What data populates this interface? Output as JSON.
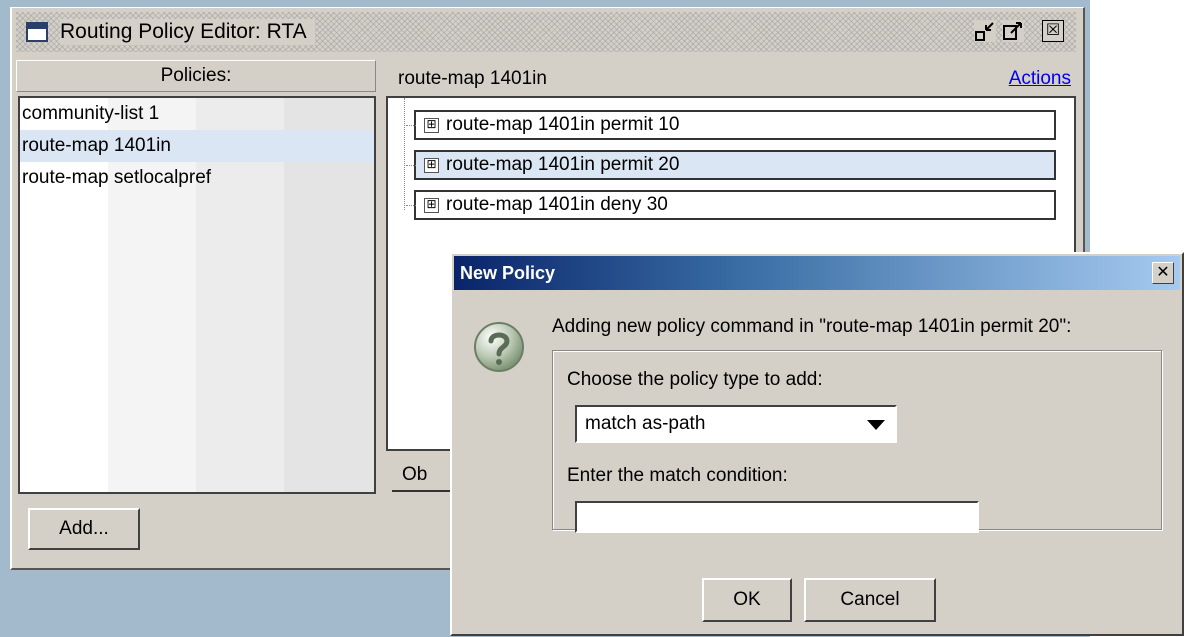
{
  "main_window": {
    "title": "Routing Policy Editor: RTA",
    "minimize_icon": "minimize-icon",
    "maximize_icon": "maximize-icon",
    "close_icon": "close-icon",
    "close_glyph": "☒"
  },
  "left_panel": {
    "header": "Policies:",
    "items": [
      {
        "label": "community-list 1",
        "selected": false
      },
      {
        "label": "route-map 1401in",
        "selected": true
      },
      {
        "label": "route-map setlocalpref",
        "selected": false
      }
    ],
    "add_button": "Add..."
  },
  "right_panel": {
    "title": "route-map 1401in",
    "actions_link": "Actions",
    "tree": [
      {
        "label": "route-map 1401in permit 10",
        "expand": "⊞",
        "selected": false
      },
      {
        "label": "route-map 1401in permit 20",
        "expand": "⊞",
        "selected": true
      },
      {
        "label": "route-map 1401in deny 30",
        "expand": "⊞",
        "selected": false
      }
    ],
    "tab_label": "Ob"
  },
  "dialog": {
    "title": "New Policy",
    "close_glyph": "✕",
    "message": "Adding new policy command in \"route-map 1401in permit 20\":",
    "choose_label": "Choose the policy type to add:",
    "selected_type": "match as-path",
    "match_label": "Enter the match condition:",
    "match_value": "",
    "ok_button": "OK",
    "cancel_button": "Cancel",
    "icon": "question-icon"
  },
  "colors": {
    "desktop": "#a3bacd",
    "window_face": "#d4d0c8",
    "selection": "#dbe6f4",
    "dialog_title_start": "#0a246a",
    "link": "#0000ee"
  }
}
